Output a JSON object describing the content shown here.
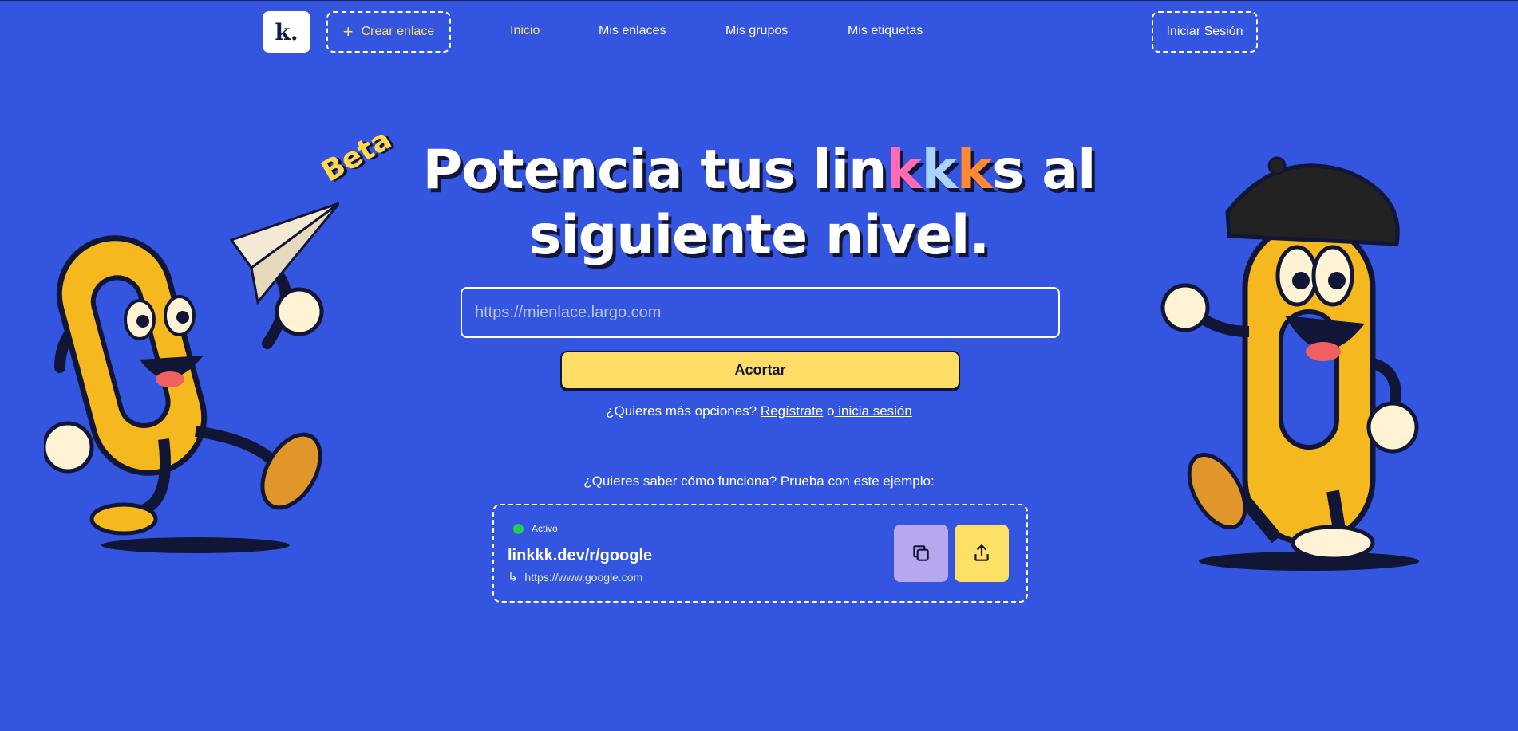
{
  "nav": {
    "logo": "k.",
    "create_link": "Crear enlace",
    "links": [
      {
        "label": "Inicio",
        "active": true
      },
      {
        "label": "Mis enlaces",
        "active": false
      },
      {
        "label": "Mis grupos",
        "active": false
      },
      {
        "label": "Mis etiquetas",
        "active": false
      }
    ],
    "login": "Iniciar Sesión"
  },
  "hero": {
    "badge": "Beta",
    "title_part1": "Potencia tus lin",
    "title_k1": "k",
    "title_k2": "k",
    "title_k3": "k",
    "title_part2": "s al",
    "title_line2": "siguiente nivel."
  },
  "form": {
    "placeholder": "https://mienlace.largo.com",
    "submit": "Acortar",
    "more_prefix": "¿Quieres más opciones?",
    "register": "Regístrate",
    "or": "o",
    "login": " inicia sesión"
  },
  "example": {
    "intro": "¿Quieres saber cómo funciona? Prueba con este ejemplo:",
    "status": "Activo",
    "short_url": "linkkk.dev/r/google",
    "destination": "https://www.google.com",
    "arrow": "↳"
  },
  "colors": {
    "background": "#3355e0",
    "accent_yellow": "#ffe066",
    "k_pink": "#ff6bb5",
    "k_blue": "#a8d4ff",
    "k_orange": "#ff8a33",
    "status_green": "#22cc55",
    "copy_button": "#b8a6ee"
  },
  "icons": [
    "plus-icon",
    "copy-icon",
    "share-icon",
    "return-arrow-icon",
    "paper-plane-icon"
  ]
}
